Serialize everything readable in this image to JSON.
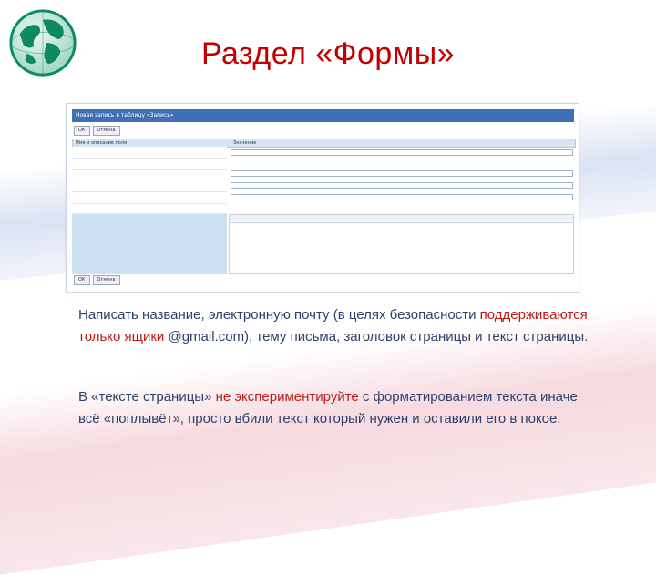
{
  "slide": {
    "title": "Раздел «Формы»",
    "logo_icon": "globe-icon"
  },
  "screenshot": {
    "header_title": "Новая запись в таблицу «Запись»",
    "toolbar_buttons": [
      "ОК",
      "Отмена"
    ],
    "columns": [
      "Имя и описание поля",
      "Значение"
    ],
    "footer_buttons": [
      "ОК",
      "Отмена"
    ]
  },
  "paragraph1": {
    "part1": "Написать название, электронную почту (в целях безопасности ",
    "part2": "поддерживаются только ящики ",
    "part3": "@gmail.com), тему письма, заголовок страницы и текст страницы."
  },
  "paragraph2": {
    "part1": "В «тексте страницы» ",
    "part2": "не экспериментируйте",
    "part3": " с форматированием текста иначе всё «поплывёт», просто вбили текст который нужен и оставили его в покое."
  },
  "colors": {
    "title": "#c00000",
    "body_text": "#2d3f6b",
    "emphasis": "#c01818",
    "header_bar": "#3f6fb7"
  }
}
